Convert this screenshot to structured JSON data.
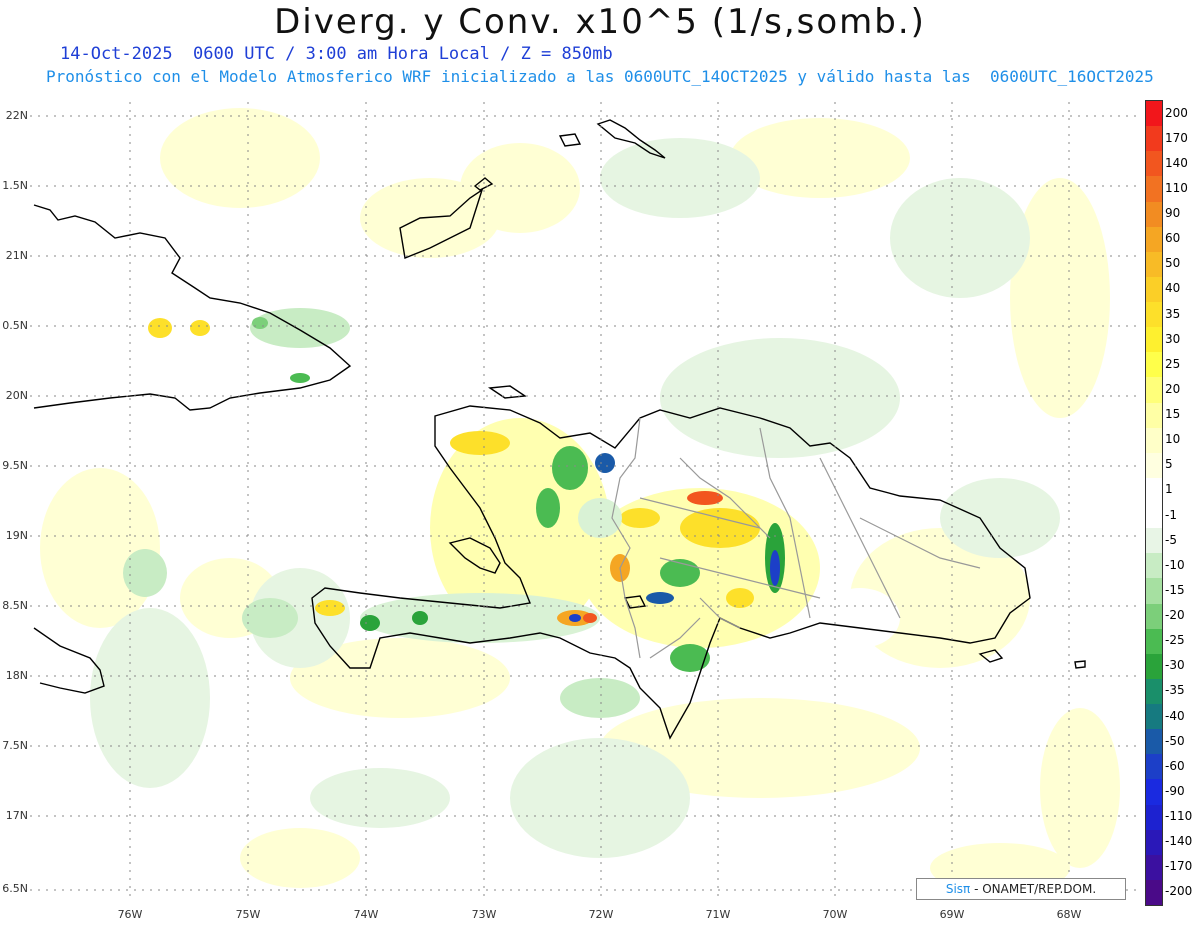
{
  "header": {
    "title": "Diverg. y Conv. x10^5 (1/s,somb.)",
    "subtitle1": "14-Oct-2025  0600 UTC / 3:00 am Hora Local / Z = 850mb",
    "subtitle2": "Pronóstico con el Modelo Atmosferico WRF inicializado a las 0600UTC_14OCT2025 y válido hasta las  0600UTC_16OCT2025"
  },
  "axes": {
    "lat_labels": [
      "22N",
      "1.5N",
      "21N",
      "0.5N",
      "20N",
      "9.5N",
      "19N",
      "8.5N",
      "18N",
      "7.5N",
      "17N",
      "6.5N"
    ],
    "lon_labels": [
      "76W",
      "75W",
      "74W",
      "73W",
      "72W",
      "71W",
      "70W",
      "69W",
      "68W"
    ]
  },
  "colorbar": {
    "labels": [
      "200",
      "170",
      "140",
      "110",
      "90",
      "60",
      "50",
      "40",
      "35",
      "30",
      "25",
      "20",
      "15",
      "10",
      "5",
      "1",
      "-1",
      "-5",
      "-10",
      "-15",
      "-20",
      "-25",
      "-30",
      "-35",
      "-40",
      "-50",
      "-60",
      "-90",
      "-110",
      "-140",
      "-170",
      "-200"
    ],
    "colors": [
      "#f2161b",
      "#f23a1d",
      "#f2561f",
      "#f27222",
      "#f28c22",
      "#f5a623",
      "#f8bb26",
      "#fbcf27",
      "#fde02a",
      "#fef02f",
      "#ffff4a",
      "#ffff7a",
      "#ffffa5",
      "#ffffc8",
      "#ffffe0",
      "#ffffff",
      "#ffffff",
      "#e8f5e6",
      "#c8ecc4",
      "#a6e0a1",
      "#7ccf7a",
      "#4bbb52",
      "#2aa33a",
      "#1a8f6a",
      "#167a80",
      "#1a5aa8",
      "#1c3fc8",
      "#1a2ae0",
      "#1d22d0",
      "#2a18b8",
      "#3b10a0",
      "#4a0a88"
    ]
  },
  "credit": {
    "brand": "Sisπ",
    "org": " - ONAMET/REP.DOM."
  },
  "colors": {
    "land_outline": "#000000",
    "province_border": "#999999",
    "grid": "#888888",
    "title_blue": "#1f3fd6",
    "subtitle_blue": "#1f8fe8"
  }
}
